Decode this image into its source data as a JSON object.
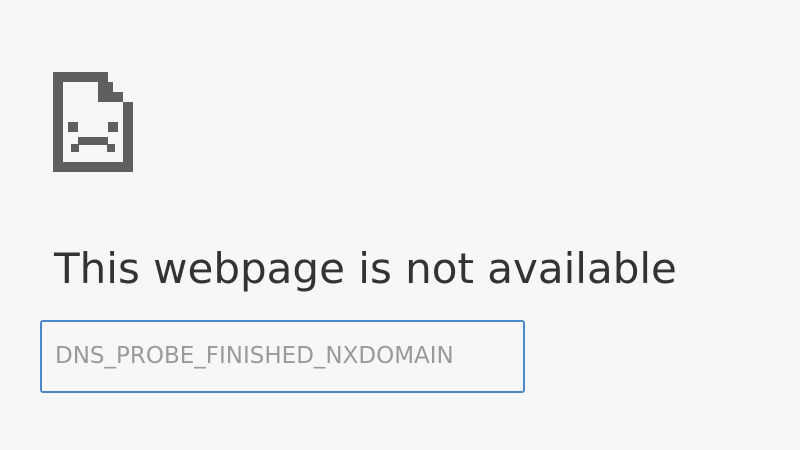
{
  "main": {
    "icon": "sad-page-icon",
    "heading": "This webpage is not available",
    "error_code": "DNS_PROBE_FINISHED_NXDOMAIN"
  },
  "colors": {
    "background": "#f7f7f7",
    "heading_text": "#333333",
    "icon": "#5f5f5f",
    "error_code_text": "#9a9a9a",
    "focus_border": "#4d87c7"
  }
}
